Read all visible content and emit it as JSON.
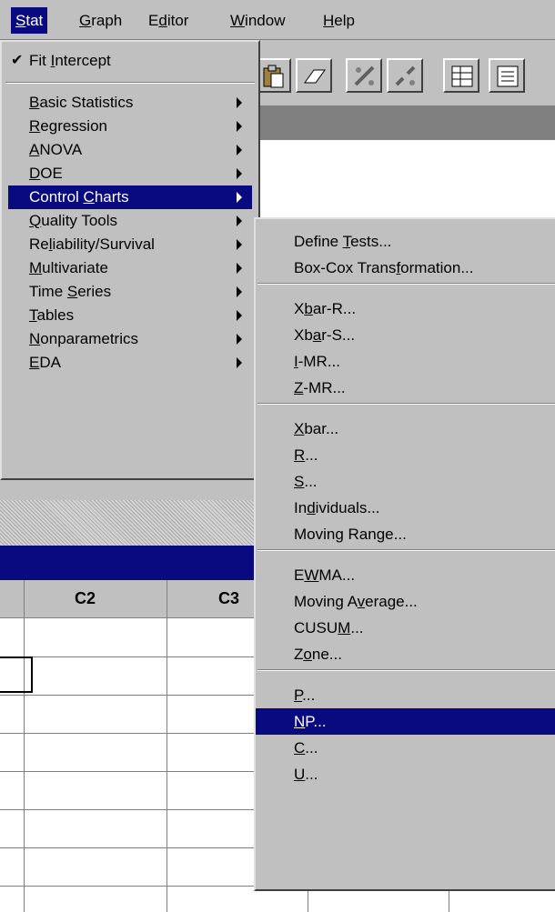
{
  "menubar": {
    "items": [
      {
        "label": "Stat",
        "u": "S",
        "rest": "tat",
        "pre": ""
      },
      {
        "label": "Graph",
        "u": "G",
        "rest": "raph",
        "pre": ""
      },
      {
        "label": "Editor",
        "u": "d",
        "rest": "itor",
        "pre": "E"
      },
      {
        "label": "Window",
        "u": "W",
        "rest": "indow",
        "pre": ""
      },
      {
        "label": "Help",
        "u": "H",
        "rest": "elp",
        "pre": ""
      }
    ]
  },
  "toolbar": {
    "icons": [
      "copy-icon",
      "paste-icon",
      "eraser-icon",
      "connect-icon",
      "disconnect-icon",
      "worksheet-icon",
      "session-icon"
    ]
  },
  "stat_menu": {
    "fit_intercept": {
      "check": "✔",
      "pre": "Fit ",
      "u": "I",
      "post": "ntercept"
    },
    "items": [
      {
        "pre": "",
        "u": "B",
        "post": "asic Statistics"
      },
      {
        "pre": "",
        "u": "R",
        "post": "egression"
      },
      {
        "pre": "",
        "u": "A",
        "post": "NOVA"
      },
      {
        "pre": "",
        "u": "D",
        "post": "OE"
      },
      {
        "pre": "Control ",
        "u": "C",
        "post": "harts"
      },
      {
        "pre": "",
        "u": "Q",
        "post": "uality Tools"
      },
      {
        "pre": "Re",
        "u": "l",
        "post": "iability/Survival"
      },
      {
        "pre": "",
        "u": "M",
        "post": "ultivariate"
      },
      {
        "pre": "Time ",
        "u": "S",
        "post": "eries"
      },
      {
        "pre": "",
        "u": "T",
        "post": "ables"
      },
      {
        "pre": "",
        "u": "N",
        "post": "onparametrics"
      },
      {
        "pre": "",
        "u": "E",
        "post": "DA"
      }
    ],
    "highlighted_index": 4
  },
  "control_charts_menu": {
    "groups": [
      [
        {
          "pre": "Define ",
          "u": "T",
          "post": "ests..."
        },
        {
          "pre": "Box-Cox Trans",
          "u": "f",
          "post": "ormation..."
        }
      ],
      [
        {
          "pre": "X",
          "u": "b",
          "post": "ar-R..."
        },
        {
          "pre": "Xb",
          "u": "a",
          "post": "r-S..."
        },
        {
          "pre": "",
          "u": "I",
          "post": "-MR..."
        },
        {
          "pre": "",
          "u": "Z",
          "post": "-MR..."
        }
      ],
      [
        {
          "pre": "",
          "u": "X",
          "post": "bar..."
        },
        {
          "pre": "",
          "u": "R",
          "post": "..."
        },
        {
          "pre": "",
          "u": "S",
          "post": "..."
        },
        {
          "pre": "In",
          "u": "d",
          "post": "ividuals..."
        },
        {
          "pre": "Moving Range...",
          "u": "",
          "post": ""
        }
      ],
      [
        {
          "pre": "E",
          "u": "W",
          "post": "MA..."
        },
        {
          "pre": "Moving A",
          "u": "v",
          "post": "erage..."
        },
        {
          "pre": "CUSU",
          "u": "M",
          "post": "..."
        },
        {
          "pre": "Z",
          "u": "o",
          "post": "ne..."
        }
      ],
      [
        {
          "pre": "",
          "u": "P",
          "post": "..."
        },
        {
          "pre": "",
          "u": "N",
          "post": "P..."
        },
        {
          "pre": "",
          "u": "C",
          "post": "..."
        },
        {
          "pre": "",
          "u": "U",
          "post": "..."
        }
      ]
    ],
    "highlighted": "NP..."
  },
  "worksheet": {
    "columns": [
      "C2",
      "C3"
    ]
  },
  "colors": {
    "menu_bg": "#c0c0c0",
    "highlight": "#0a0a80",
    "highlight_text": "#ffffff"
  }
}
